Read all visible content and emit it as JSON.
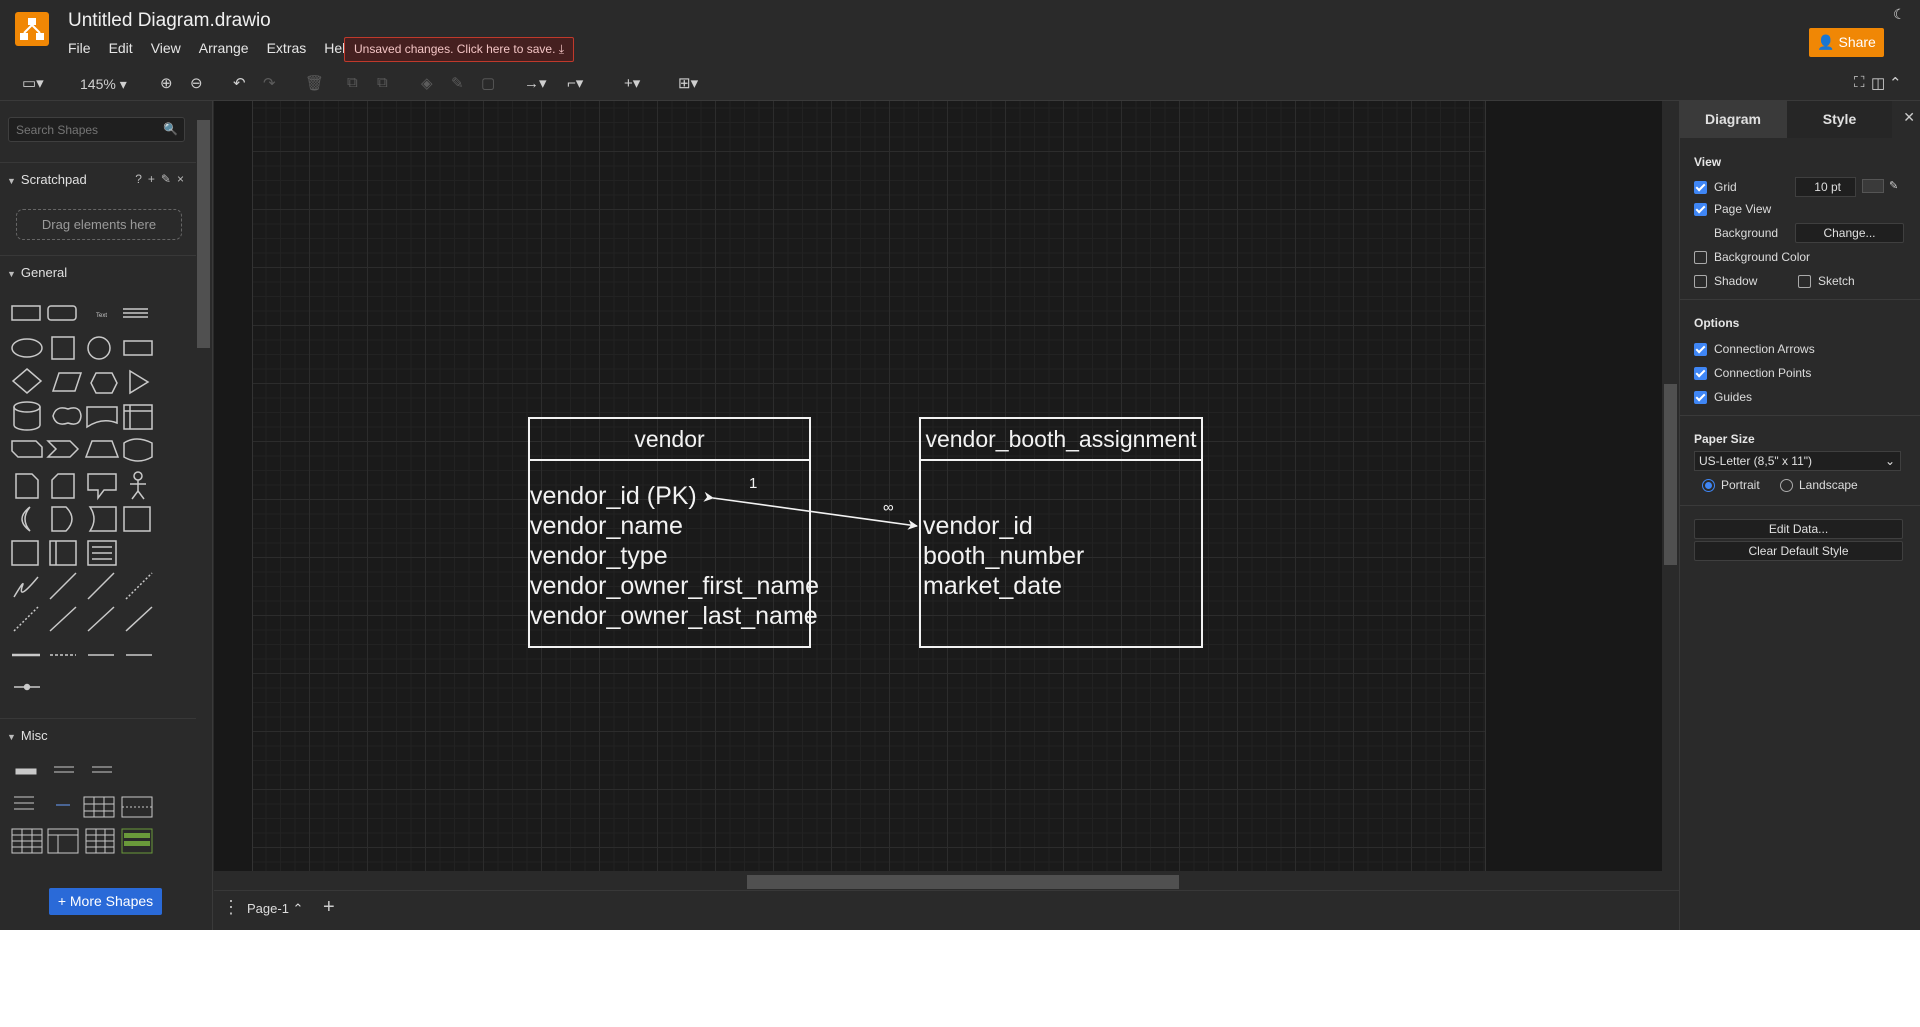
{
  "app": {
    "title": "Untitled Diagram.drawio"
  },
  "menu": [
    "File",
    "Edit",
    "View",
    "Arrange",
    "Extras",
    "Help"
  ],
  "unsaved": "Unsaved changes. Click here to save.",
  "share": "Share",
  "toolbar": {
    "zoom": "145%"
  },
  "sidebar": {
    "search_placeholder": "Search Shapes",
    "scratchpad": "Scratchpad",
    "dropzone": "Drag elements here",
    "general": "General",
    "misc": "Misc",
    "more_shapes": "+ More Shapes"
  },
  "diagram": {
    "entities": [
      {
        "name": "vendor",
        "fields": [
          "vendor_id (PK)",
          "vendor_name",
          "vendor_type",
          "vendor_owner_first_name",
          "vendor_owner_last_name"
        ]
      },
      {
        "name": "vendor_booth_assignment",
        "fields": [
          "vendor_id",
          "booth_number",
          "market_date"
        ]
      }
    ],
    "relation": {
      "from_label": "1",
      "to_label": "∞"
    }
  },
  "pages": {
    "tab": "Page-1"
  },
  "format_panel": {
    "tabs": [
      "Diagram",
      "Style"
    ],
    "view": "View",
    "grid": "Grid",
    "grid_size": "10 pt",
    "page_view": "Page View",
    "background": "Background",
    "change": "Change...",
    "background_color": "Background Color",
    "shadow": "Shadow",
    "sketch": "Sketch",
    "options": "Options",
    "connection_arrows": "Connection Arrows",
    "connection_points": "Connection Points",
    "guides": "Guides",
    "paper_size": "Paper Size",
    "paper_value": "US-Letter (8,5\" x 11\")",
    "portrait": "Portrait",
    "landscape": "Landscape",
    "edit_data": "Edit Data...",
    "clear_style": "Clear Default Style"
  },
  "colors": {
    "accent": "#f08705",
    "checkbox": "#3f86f5",
    "unsaved_border": "#c0392b",
    "more_shapes": "#2a6ad8"
  }
}
